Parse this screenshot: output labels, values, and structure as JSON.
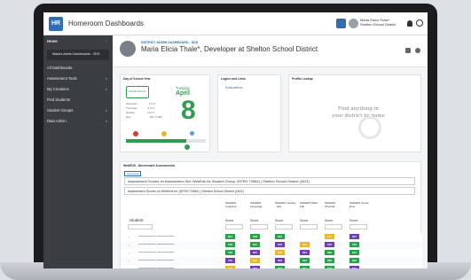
{
  "app": {
    "title": "Homeroom Dashboards",
    "logo_text": "HR"
  },
  "user": {
    "name": "Maria Elicia Thale*",
    "role": "Shelton School District"
  },
  "sidebar": {
    "items": [
      {
        "label": "Home"
      },
      {
        "label": "Maria's Admin Dashboards - SDS"
      },
      {
        "label": "All Dashboards"
      },
      {
        "label": "Assessment Tools"
      },
      {
        "label": "My Creations"
      },
      {
        "label": "Find Students"
      },
      {
        "label": "Student Groups"
      },
      {
        "label": "Data Admin"
      }
    ]
  },
  "header": {
    "breadcrumb": "DISTRICT ADMIN DASHBOARD - SDS",
    "title": "Maria Elicia Thale*, Developer at Shelton School District"
  },
  "day_card": {
    "title": "Day of School Year",
    "weekday": "Tuesday",
    "month": "April",
    "day": "8",
    "badge": "Official District",
    "rows": [
      {
        "k": "Semester",
        "v": "2 of 2"
      },
      {
        "k": "Trimester",
        "v": "3 of 3"
      },
      {
        "k": "Quarter",
        "v": "4 of 4"
      },
      {
        "k": "Day",
        "v": "136 of 180"
      }
    ],
    "progress": 0.75
  },
  "logins_card": {
    "title": "Logins and Links",
    "link": "Evaluations"
  },
  "profile_card": {
    "title": "Profile Lookup",
    "placeholder": "Find anything in your district by name"
  },
  "wida": {
    "title": "WebEDS - Benchmark Assessments",
    "tag": "Launched",
    "filter1": "Assessment Scores on Assessment Set: WebEds for Student Group: (DFEH 73964) | Shelton School District (2021)",
    "filter2": "Assessment Scores on WebEds for (DFEH 73964) | Shelton School District (2021)",
    "columns": [
      "WebEDS Cognitive",
      "WebEDS Language",
      "WebEDS Literacy - Fall",
      "WebEDS Math - Fall",
      "WebEDS Physical",
      "WebEDS Social Emo"
    ],
    "col_score": "Score",
    "student_label": "Student",
    "rows": [
      {
        "name": "***************** *****************",
        "scores": [
          "661",
          "538",
          "640",
          "",
          "712",
          "627"
        ]
      },
      {
        "name": "***************** *****************",
        "scores": [
          "756",
          "667",
          "678",
          "601",
          "678",
          "756"
        ]
      },
      {
        "name": "***************** *****************",
        "scores": [
          "756",
          "667",
          "678",
          "601",
          "656",
          "914"
        ]
      },
      {
        "name": "***************** *****************",
        "scores": [
          "756",
          "594",
          "655",
          "601",
          "690",
          "632"
        ]
      },
      {
        "name": "***************** *****************",
        "scores": [
          "756",
          "667",
          "678",
          "601",
          "578",
          "527"
        ]
      }
    ]
  },
  "colors": {
    "accent": "#2f6db5",
    "green": "#2e9d4e",
    "purple": "#6c3fb0",
    "yellow": "#e8b630",
    "red": "#cf3e2f"
  }
}
